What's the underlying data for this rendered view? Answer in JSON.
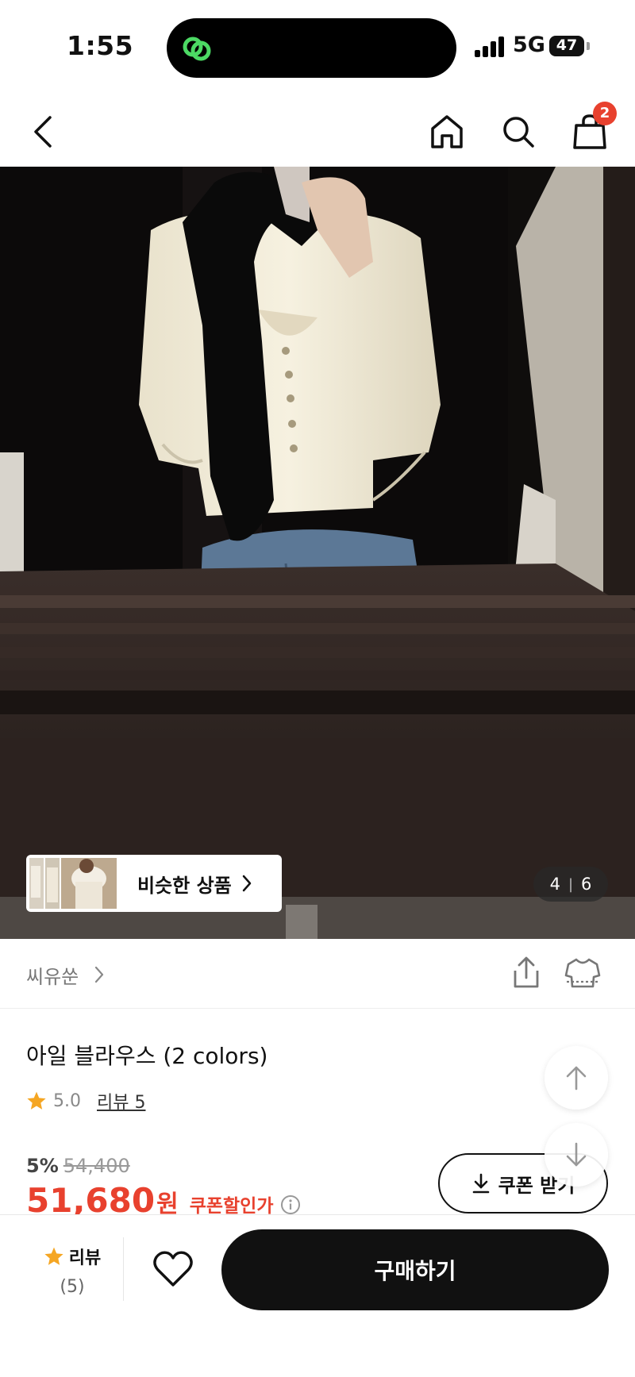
{
  "status_bar": {
    "time": "1:55",
    "network": "5G",
    "battery": "47"
  },
  "nav": {
    "cart_count": "2",
    "icons": [
      "back-icon",
      "home-icon",
      "search-icon",
      "shopping-bag-icon"
    ]
  },
  "gallery": {
    "similar_label": "비슷한 상품",
    "current": "4",
    "total": "6"
  },
  "seller": {
    "name": "씨유쑨"
  },
  "product": {
    "title": "아일 블라우스 (2 colors)",
    "rating": "5.0",
    "review_label": "리뷰 5",
    "discount": "5%",
    "original_price": "54,400",
    "final_price": "51,680",
    "currency": "원",
    "coupon_price_label": "쿠폰할인가",
    "coupon_button": "쿠폰 받기"
  },
  "bottom_bar": {
    "review_label": "리뷰",
    "review_count": "(5)",
    "buy_label": "구매하기"
  },
  "colors": {
    "accent_red": "#e8412e",
    "star": "#f5a623",
    "button_dark": "#111111"
  }
}
